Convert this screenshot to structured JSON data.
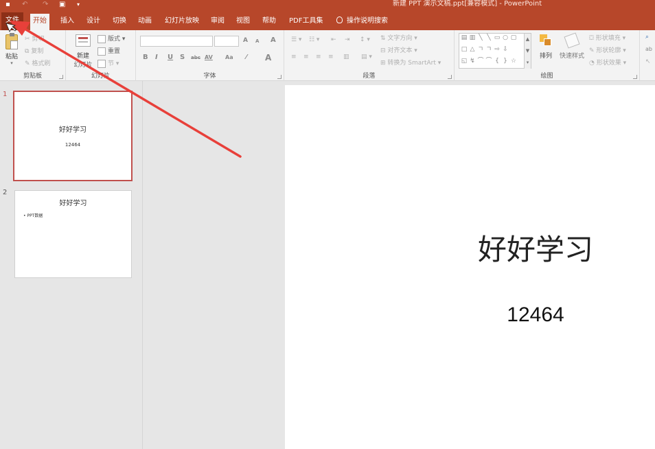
{
  "window": {
    "title": "新建 PPT 演示文稿.ppt[兼容模式] - PowerPoint",
    "qat": [
      "save-icon",
      "undo-icon",
      "redo-icon",
      "present-icon",
      "customize-icon"
    ]
  },
  "tabs": [
    {
      "label": "文件"
    },
    {
      "label": "开始"
    },
    {
      "label": "插入"
    },
    {
      "label": "设计"
    },
    {
      "label": "切换"
    },
    {
      "label": "动画"
    },
    {
      "label": "幻灯片放映"
    },
    {
      "label": "审阅"
    },
    {
      "label": "视图"
    },
    {
      "label": "帮助"
    },
    {
      "label": "PDF工具集"
    },
    {
      "label": "操作说明搜索"
    }
  ],
  "ribbon": {
    "clipboard": {
      "label": "剪贴板",
      "paste": "粘贴",
      "cut": "剪切",
      "copy": "复制",
      "format_painter": "格式刷"
    },
    "slides": {
      "label": "幻灯片",
      "new_slide": "新建",
      "new_slide_line2": "幻灯片",
      "layout": "版式",
      "reset": "重置",
      "section": "节"
    },
    "font": {
      "label": "字体",
      "bold": "B",
      "italic": "I",
      "underline": "U",
      "shadow": "S",
      "strike": "abc",
      "spacing": "AV",
      "case": "Aa",
      "grow": "A",
      "shrink": "A",
      "clear": "A",
      "color": "A"
    },
    "paragraph": {
      "label": "段落",
      "text_direction": "文字方向",
      "align_text": "对齐文本",
      "smartart": "转换为 SmartArt"
    },
    "drawing": {
      "label": "绘图",
      "arrange": "排列",
      "quick_styles": "快速样式",
      "shape_fill": "形状填充",
      "shape_outline": "形状轮廓",
      "shape_effects": "形状效果"
    }
  },
  "thumbnails": [
    {
      "number": "1",
      "title": "好好学习",
      "subtitle": "12464"
    },
    {
      "number": "2",
      "title": "好好学习",
      "bullet": "• PPT数据"
    }
  ],
  "slide": {
    "title": "好好学习",
    "subtitle": "12464"
  },
  "colors": {
    "accent": "#b7472a",
    "arrow": "#e8403a"
  }
}
